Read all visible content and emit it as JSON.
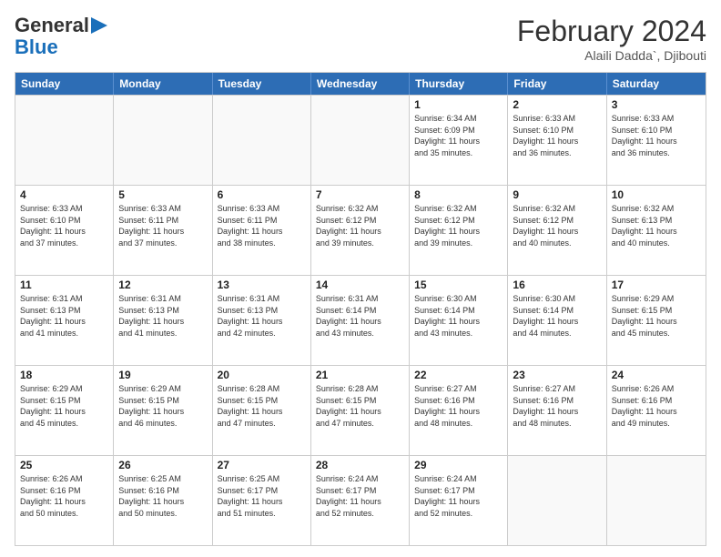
{
  "header": {
    "logo_general": "General",
    "logo_blue": "Blue",
    "month_year": "February 2024",
    "location": "Alaili Dadda`, Djibouti"
  },
  "weekdays": [
    "Sunday",
    "Monday",
    "Tuesday",
    "Wednesday",
    "Thursday",
    "Friday",
    "Saturday"
  ],
  "rows": [
    [
      {
        "day": "",
        "info": ""
      },
      {
        "day": "",
        "info": ""
      },
      {
        "day": "",
        "info": ""
      },
      {
        "day": "",
        "info": ""
      },
      {
        "day": "1",
        "info": "Sunrise: 6:34 AM\nSunset: 6:09 PM\nDaylight: 11 hours\nand 35 minutes."
      },
      {
        "day": "2",
        "info": "Sunrise: 6:33 AM\nSunset: 6:10 PM\nDaylight: 11 hours\nand 36 minutes."
      },
      {
        "day": "3",
        "info": "Sunrise: 6:33 AM\nSunset: 6:10 PM\nDaylight: 11 hours\nand 36 minutes."
      }
    ],
    [
      {
        "day": "4",
        "info": "Sunrise: 6:33 AM\nSunset: 6:10 PM\nDaylight: 11 hours\nand 37 minutes."
      },
      {
        "day": "5",
        "info": "Sunrise: 6:33 AM\nSunset: 6:11 PM\nDaylight: 11 hours\nand 37 minutes."
      },
      {
        "day": "6",
        "info": "Sunrise: 6:33 AM\nSunset: 6:11 PM\nDaylight: 11 hours\nand 38 minutes."
      },
      {
        "day": "7",
        "info": "Sunrise: 6:32 AM\nSunset: 6:12 PM\nDaylight: 11 hours\nand 39 minutes."
      },
      {
        "day": "8",
        "info": "Sunrise: 6:32 AM\nSunset: 6:12 PM\nDaylight: 11 hours\nand 39 minutes."
      },
      {
        "day": "9",
        "info": "Sunrise: 6:32 AM\nSunset: 6:12 PM\nDaylight: 11 hours\nand 40 minutes."
      },
      {
        "day": "10",
        "info": "Sunrise: 6:32 AM\nSunset: 6:13 PM\nDaylight: 11 hours\nand 40 minutes."
      }
    ],
    [
      {
        "day": "11",
        "info": "Sunrise: 6:31 AM\nSunset: 6:13 PM\nDaylight: 11 hours\nand 41 minutes."
      },
      {
        "day": "12",
        "info": "Sunrise: 6:31 AM\nSunset: 6:13 PM\nDaylight: 11 hours\nand 41 minutes."
      },
      {
        "day": "13",
        "info": "Sunrise: 6:31 AM\nSunset: 6:13 PM\nDaylight: 11 hours\nand 42 minutes."
      },
      {
        "day": "14",
        "info": "Sunrise: 6:31 AM\nSunset: 6:14 PM\nDaylight: 11 hours\nand 43 minutes."
      },
      {
        "day": "15",
        "info": "Sunrise: 6:30 AM\nSunset: 6:14 PM\nDaylight: 11 hours\nand 43 minutes."
      },
      {
        "day": "16",
        "info": "Sunrise: 6:30 AM\nSunset: 6:14 PM\nDaylight: 11 hours\nand 44 minutes."
      },
      {
        "day": "17",
        "info": "Sunrise: 6:29 AM\nSunset: 6:15 PM\nDaylight: 11 hours\nand 45 minutes."
      }
    ],
    [
      {
        "day": "18",
        "info": "Sunrise: 6:29 AM\nSunset: 6:15 PM\nDaylight: 11 hours\nand 45 minutes."
      },
      {
        "day": "19",
        "info": "Sunrise: 6:29 AM\nSunset: 6:15 PM\nDaylight: 11 hours\nand 46 minutes."
      },
      {
        "day": "20",
        "info": "Sunrise: 6:28 AM\nSunset: 6:15 PM\nDaylight: 11 hours\nand 47 minutes."
      },
      {
        "day": "21",
        "info": "Sunrise: 6:28 AM\nSunset: 6:15 PM\nDaylight: 11 hours\nand 47 minutes."
      },
      {
        "day": "22",
        "info": "Sunrise: 6:27 AM\nSunset: 6:16 PM\nDaylight: 11 hours\nand 48 minutes."
      },
      {
        "day": "23",
        "info": "Sunrise: 6:27 AM\nSunset: 6:16 PM\nDaylight: 11 hours\nand 48 minutes."
      },
      {
        "day": "24",
        "info": "Sunrise: 6:26 AM\nSunset: 6:16 PM\nDaylight: 11 hours\nand 49 minutes."
      }
    ],
    [
      {
        "day": "25",
        "info": "Sunrise: 6:26 AM\nSunset: 6:16 PM\nDaylight: 11 hours\nand 50 minutes."
      },
      {
        "day": "26",
        "info": "Sunrise: 6:25 AM\nSunset: 6:16 PM\nDaylight: 11 hours\nand 50 minutes."
      },
      {
        "day": "27",
        "info": "Sunrise: 6:25 AM\nSunset: 6:17 PM\nDaylight: 11 hours\nand 51 minutes."
      },
      {
        "day": "28",
        "info": "Sunrise: 6:24 AM\nSunset: 6:17 PM\nDaylight: 11 hours\nand 52 minutes."
      },
      {
        "day": "29",
        "info": "Sunrise: 6:24 AM\nSunset: 6:17 PM\nDaylight: 11 hours\nand 52 minutes."
      },
      {
        "day": "",
        "info": ""
      },
      {
        "day": "",
        "info": ""
      }
    ]
  ]
}
